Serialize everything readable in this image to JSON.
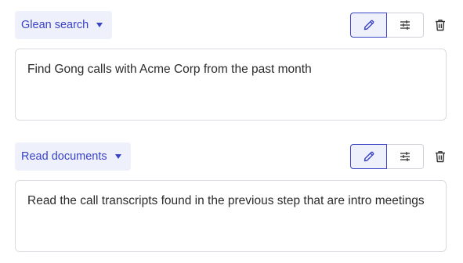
{
  "steps": [
    {
      "action_label": "Glean search",
      "prompt": "Find Gong calls with Acme Corp from the past month",
      "icons": {
        "edit": "pencil-icon",
        "settings": "sliders-icon",
        "delete": "trash-icon",
        "dropdown": "chevron-down-icon"
      }
    },
    {
      "action_label": "Read documents",
      "prompt": "Read the call transcripts found in the previous step that are intro meetings",
      "icons": {
        "edit": "pencil-icon",
        "settings": "sliders-icon",
        "delete": "trash-icon",
        "dropdown": "chevron-down-icon"
      }
    }
  ],
  "colors": {
    "accent": "#3b43c7",
    "accent_bg": "#eef0fb",
    "border": "#d9dbe0",
    "text": "#2b2b2b"
  }
}
